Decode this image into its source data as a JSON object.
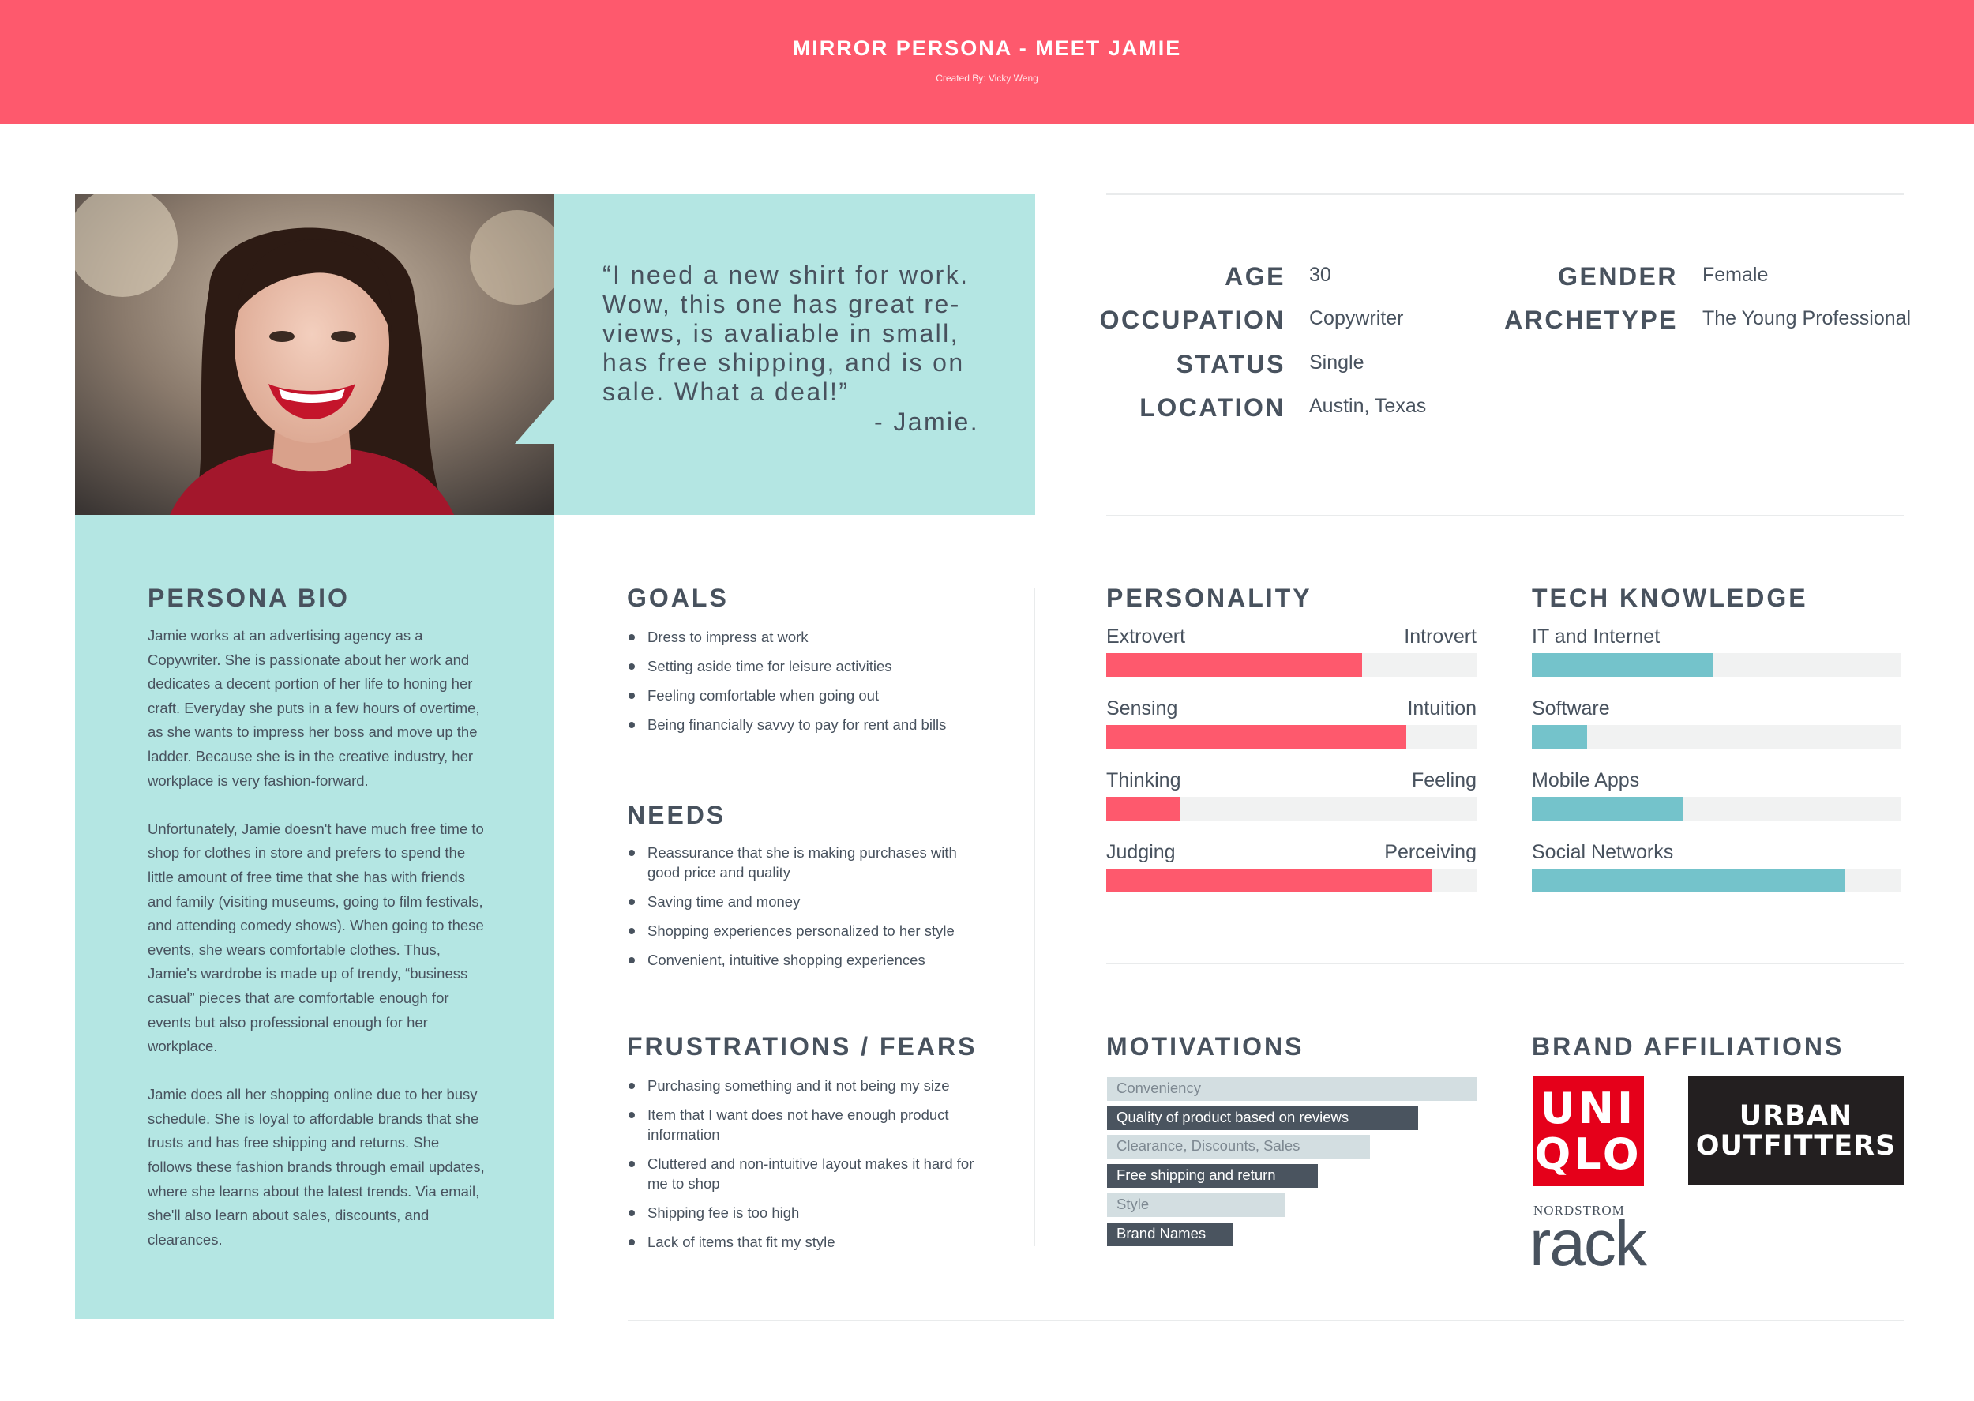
{
  "header": {
    "title": "MIRROR PERSONA - MEET JAMIE",
    "subtitle": "Created By: Vicky Weng"
  },
  "quote": {
    "text": "“I need a new shirt for work. Wow, this one has great re-views, is avaliable in small, has free shipping, and is on sale. What a deal!”",
    "signature": "- Jamie."
  },
  "demographics": {
    "age_label": "AGE",
    "age": "30",
    "occupation_label": "OCCUPATION",
    "occupation": "Copywriter",
    "status_label": "STATUS",
    "status": "Single",
    "location_label": "LOCATION",
    "location": "Austin, Texas",
    "gender_label": "GENDER",
    "gender": "Female",
    "archetype_label": "ARCHETYPE",
    "archetype": "The Young Professional"
  },
  "bio": {
    "title": "PERSONA BIO",
    "paragraphs": [
      "Jamie works at an advertising agency as a Copywriter. She is passionate about her work and dedicates a decent portion of her life to honing her craft. Everyday she puts in a few hours of overtime, as she wants to impress her boss and move up the ladder. Because she is in the creative industry, her workplace is very fashion-forward.",
      "Unfortunately, Jamie doesn't have much free time to shop for clothes in store and prefers to spend the little amount of free time that she has with friends and family (visiting museums, going to film festivals, and attending comedy shows). When going to these events, she wears comfortable clothes. Thus, Jamie's wardrobe is made up of trendy, “business casual” pieces that are comfortable enough for events but also professional enough for her workplace.",
      "Jamie does all her shopping online due to her busy schedule. She is loyal to affordable brands that she trusts and has free shipping and returns. She follows these fashion brands through email updates, where she learns about the latest trends. Via email, she'll also learn about sales, discounts, and clearances."
    ]
  },
  "goals": {
    "title": "GOALS",
    "items": [
      "Dress to impress at work",
      "Setting aside time for leisure activities",
      "Feeling comfortable when going out",
      "Being financially savvy to pay for rent and bills"
    ]
  },
  "needs": {
    "title": "NEEDS",
    "items": [
      "Reassurance that she is making purchases with good price and quality",
      "Saving time and money",
      "Shopping experiences personalized to her style",
      "Convenient, intuitive shopping experiences"
    ]
  },
  "frustrations": {
    "title": "FRUSTRATIONS / FEARS",
    "items": [
      "Purchasing something and it not being my size",
      "Item that I want does not have enough product information",
      "Cluttered and non-intuitive layout makes it hard for me to shop",
      "Shipping fee is too high",
      "Lack of items that fit my style"
    ]
  },
  "personality": {
    "title": "PERSONALITY",
    "color": "#fe596d",
    "traits": [
      {
        "left": "Extrovert",
        "right": "Introvert",
        "value": 0.69
      },
      {
        "left": "Sensing",
        "right": "Intuition",
        "value": 0.81
      },
      {
        "left": "Thinking",
        "right": "Feeling",
        "value": 0.2
      },
      {
        "left": "Judging",
        "right": "Perceiving",
        "value": 0.88
      }
    ]
  },
  "tech": {
    "title": "TECH KNOWLEDGE",
    "color": "#74c3cb",
    "items": [
      {
        "label": "IT and Internet",
        "value": 0.49
      },
      {
        "label": "Software",
        "value": 0.15
      },
      {
        "label": "Mobile Apps",
        "value": 0.41
      },
      {
        "label": "Social Networks",
        "value": 0.85
      }
    ]
  },
  "motivations": {
    "title": "MOTIVATIONS",
    "items": [
      {
        "label": "Conveniency",
        "value": 1.0,
        "style": "light"
      },
      {
        "label": "Quality of product based on reviews",
        "value": 0.84,
        "style": "dark"
      },
      {
        "label": "Clearance, Discounts, Sales",
        "value": 0.71,
        "style": "light"
      },
      {
        "label": "Free shipping and return",
        "value": 0.57,
        "style": "dark"
      },
      {
        "label": "Style",
        "value": 0.48,
        "style": "light"
      },
      {
        "label": "Brand Names",
        "value": 0.34,
        "style": "dark"
      }
    ],
    "light_color": "#d3dee1",
    "dark_color": "#4a545f"
  },
  "brands": {
    "title": "BRAND AFFILIATIONS",
    "uniqlo": [
      "UNI",
      "QLO"
    ],
    "urban": [
      "URBAN",
      "OUTFITTERS"
    ],
    "nordstrom_top": "NORDSTROM",
    "nordstrom_bottom": "rack"
  }
}
